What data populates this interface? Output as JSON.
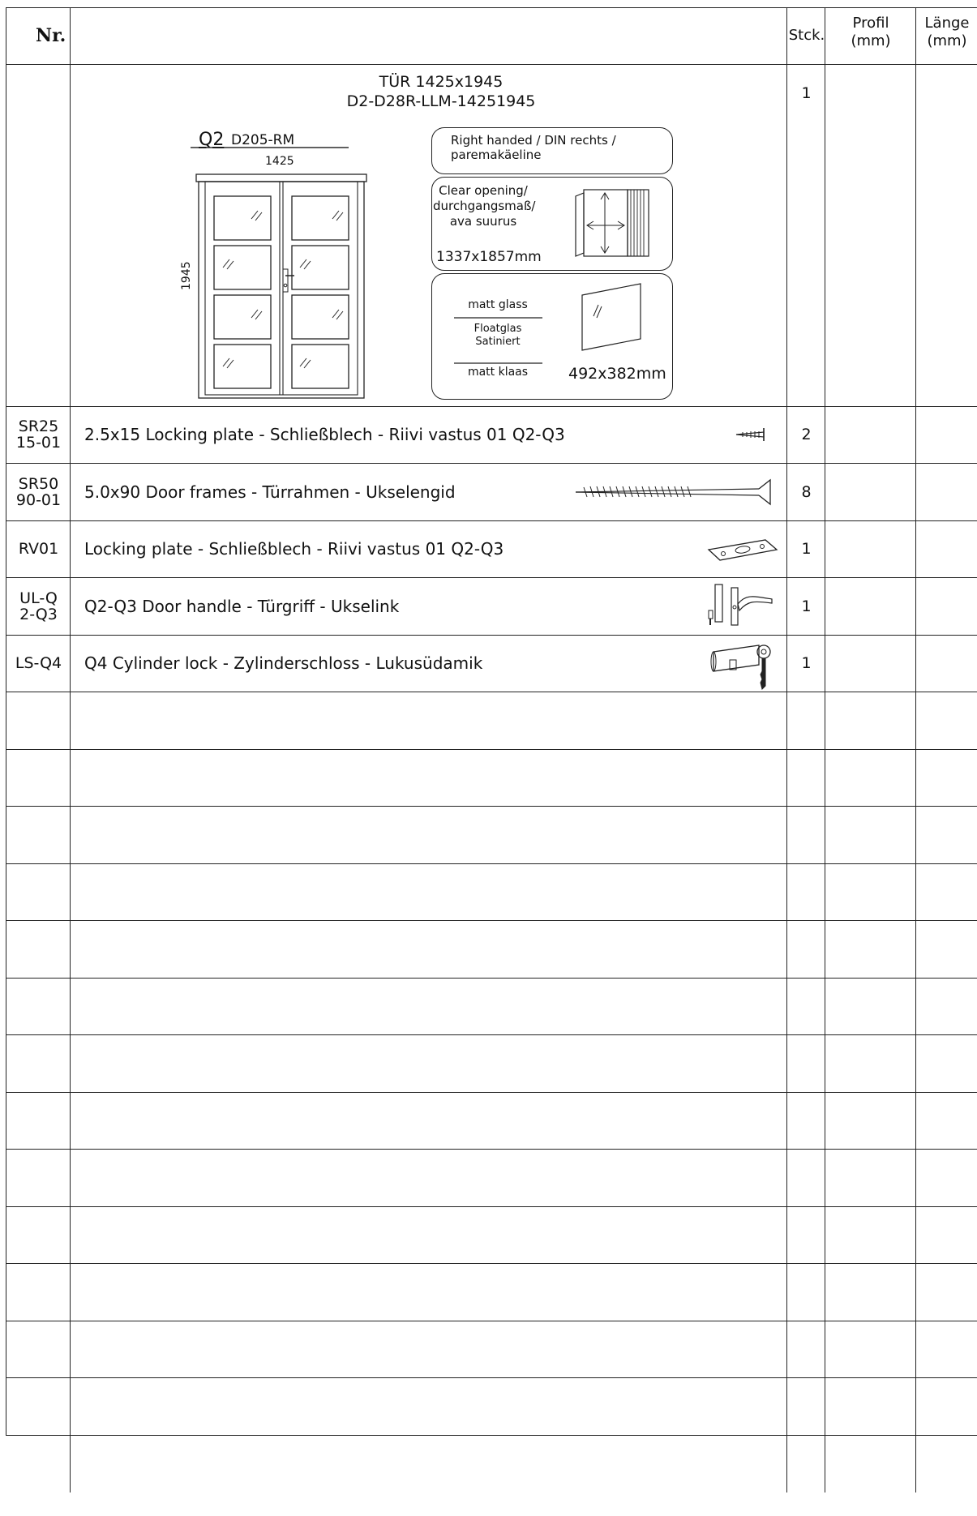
{
  "header": {
    "nr": "Nr.",
    "qty": "Stck.",
    "profile_line1": "Profil",
    "profile_line2": "(mm)",
    "length_line1": "Länge",
    "length_line2": "(mm)"
  },
  "door": {
    "qty": "1",
    "title_line1": "TÜR 1425x1945",
    "title_line2": "D2-D28R-LLM-14251945",
    "model": "Q2",
    "model_code": "D205-RM",
    "width_label": "1425",
    "height_label": "1945",
    "handing": "Right handed / DIN rechts /\nparemakäeline",
    "opening_text": "Clear opening/\ndurchgangsmaß/\nava suurus",
    "opening_size": "1337x1857mm",
    "glass_1": "matt glass",
    "glass_2": "Floatglas\nSatiniert",
    "glass_3": "matt klaas",
    "glass_size": "492x382mm"
  },
  "items": [
    {
      "code": "SR25\n15-01",
      "description": "2.5x15   Locking plate - Schließblech - Riivi vastus 01 Q2-Q3",
      "qty": "2",
      "icon": "small-screw-icon"
    },
    {
      "code": "SR50\n90-01",
      "description": "5.0x90   Door frames - Türrahmen - Ukselengid",
      "qty": "8",
      "icon": "long-screw-icon"
    },
    {
      "code": "RV01",
      "description": "Locking plate - Schließblech - Riivi vastus 01 Q2-Q3",
      "qty": "1",
      "icon": "locking-plate-icon"
    },
    {
      "code": "UL-Q\n2-Q3",
      "description": "Q2-Q3 Door handle - Türgriff - Ukselink",
      "qty": "1",
      "icon": "door-handle-icon"
    },
    {
      "code": "LS-Q4",
      "description": "Q4 Cylinder lock - Zylinderschloss - Lukusüdamik",
      "qty": "1",
      "icon": "cylinder-lock-icon"
    }
  ]
}
